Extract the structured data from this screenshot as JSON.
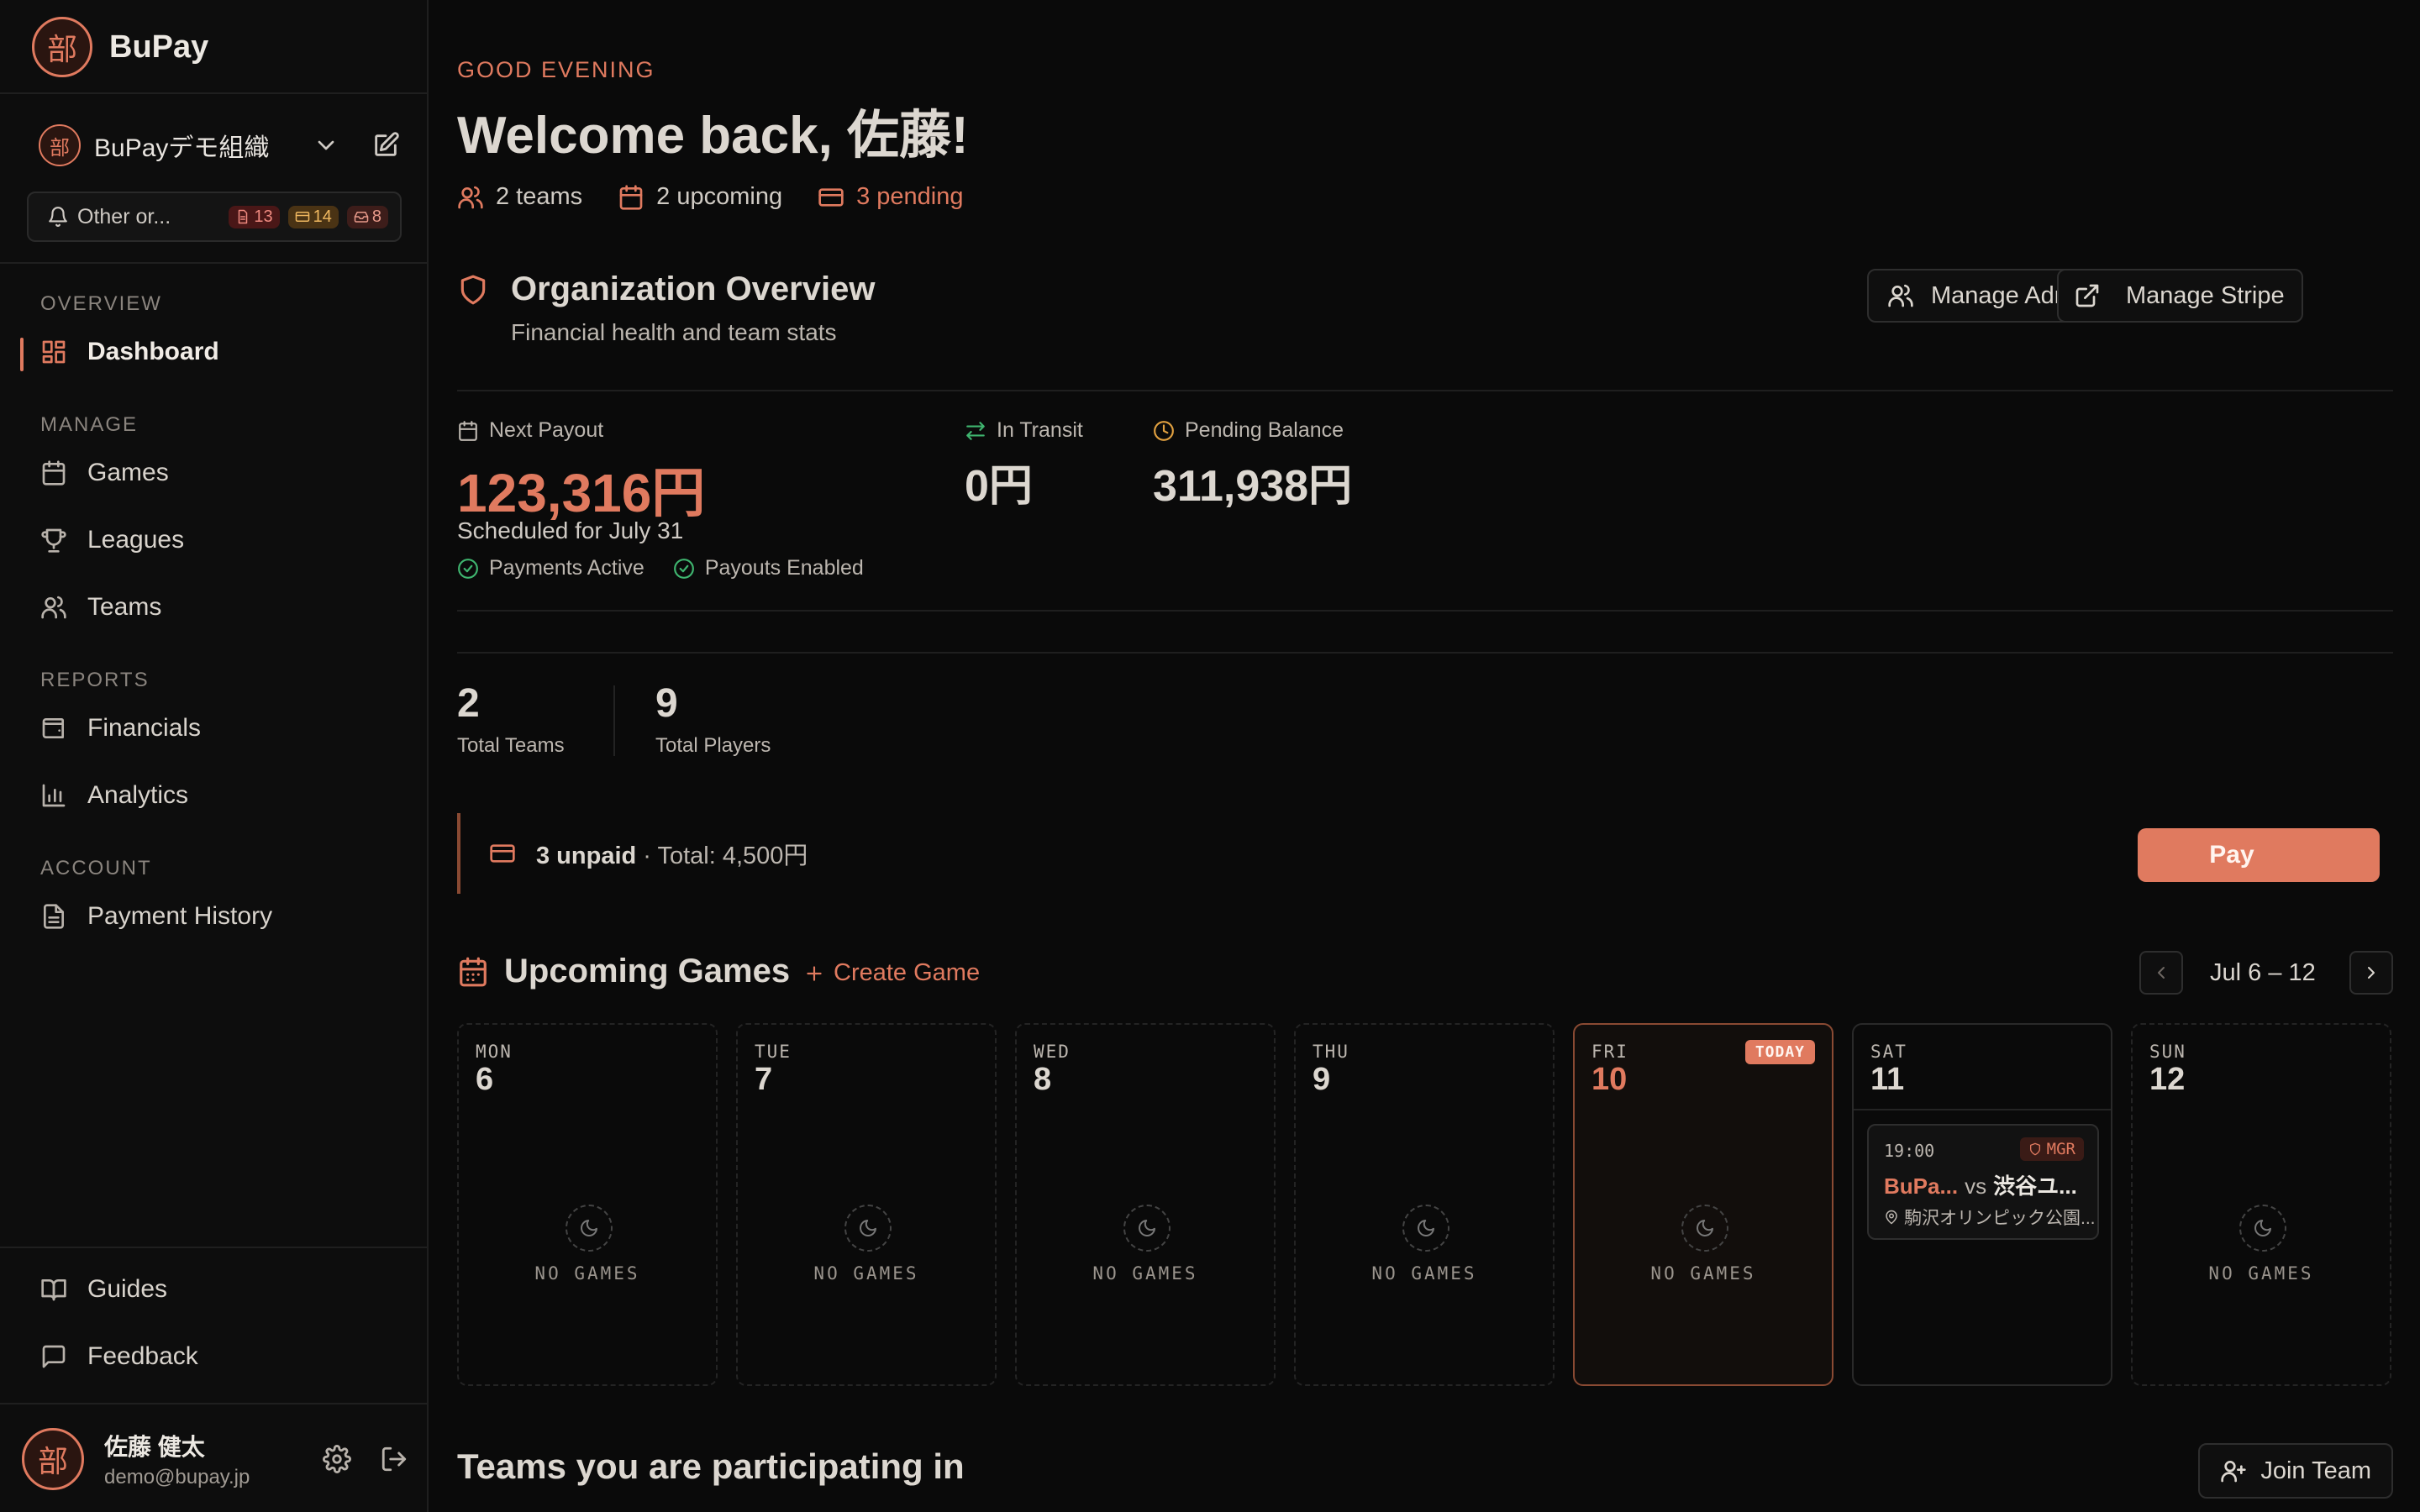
{
  "brand": {
    "name": "BuPay",
    "logo_glyph": "部"
  },
  "org": {
    "name": "BuPayデモ組織",
    "logo_glyph": "部"
  },
  "notifications": {
    "label": "Other or...",
    "badges": [
      "13",
      "14",
      "8"
    ]
  },
  "sidebar": {
    "sections": [
      {
        "title": "OVERVIEW",
        "items": [
          {
            "label": "Dashboard",
            "icon": "grid-icon",
            "active": true
          }
        ]
      },
      {
        "title": "MANAGE",
        "items": [
          {
            "label": "Games",
            "icon": "calendar-icon"
          },
          {
            "label": "Leagues",
            "icon": "trophy-icon"
          },
          {
            "label": "Teams",
            "icon": "users-icon"
          }
        ]
      },
      {
        "title": "REPORTS",
        "items": [
          {
            "label": "Financials",
            "icon": "wallet-icon"
          },
          {
            "label": "Analytics",
            "icon": "bar-chart-icon"
          }
        ]
      },
      {
        "title": "ACCOUNT",
        "items": [
          {
            "label": "Payment History",
            "icon": "document-icon"
          }
        ]
      }
    ],
    "footer": [
      {
        "label": "Guides",
        "icon": "book-icon"
      },
      {
        "label": "Feedback",
        "icon": "message-icon"
      }
    ]
  },
  "user": {
    "name": "佐藤 健太",
    "email": "demo@bupay.jp",
    "avatar_glyph": "部"
  },
  "header": {
    "greeting": "GOOD EVENING",
    "welcome": "Welcome back, 佐藤!",
    "stats": {
      "teams": "2 teams",
      "upcoming": "2 upcoming",
      "pending": "3 pending"
    }
  },
  "overview": {
    "title": "Organization Overview",
    "subtitle": "Financial health and team stats",
    "manage_admins": "Manage Admins",
    "manage_stripe": "Manage Stripe",
    "next_payout": {
      "label": "Next Payout",
      "value": "123,316円",
      "scheduled": "Scheduled for July 31"
    },
    "in_transit": {
      "label": "In Transit",
      "value": "0円"
    },
    "pending_balance": {
      "label": "Pending Balance",
      "value": "311,938円"
    },
    "checks": [
      "Payments Active",
      "Payouts Enabled"
    ],
    "total_teams": {
      "value": "2",
      "label": "Total Teams"
    },
    "total_players": {
      "value": "9",
      "label": "Total Players"
    }
  },
  "unpaid": {
    "count": "3 unpaid",
    "total": " · Total: 4,500円",
    "pay": "Pay"
  },
  "upcoming": {
    "title": "Upcoming Games",
    "create": "Create Game",
    "week": "Jul 6 – 12",
    "empty": "NO GAMES",
    "today_label": "TODAY",
    "days": [
      {
        "name": "MON",
        "num": "6"
      },
      {
        "name": "TUE",
        "num": "7"
      },
      {
        "name": "WED",
        "num": "8"
      },
      {
        "name": "THU",
        "num": "9"
      },
      {
        "name": "FRI",
        "num": "10",
        "today": true
      },
      {
        "name": "SAT",
        "num": "11"
      },
      {
        "name": "SUN",
        "num": "12"
      }
    ],
    "game": {
      "time": "19:00",
      "badge": "MGR",
      "home": "BuPa...",
      "vs": "vs",
      "away": "渋谷ユ...",
      "location": "駒沢オリンピック公園..."
    }
  },
  "teams_section": {
    "title": "Teams you are participating in",
    "join": "Join Team"
  },
  "colors": {
    "accent": "#e07a5f",
    "success": "#3fb56f",
    "background": "#0a0a0a"
  }
}
